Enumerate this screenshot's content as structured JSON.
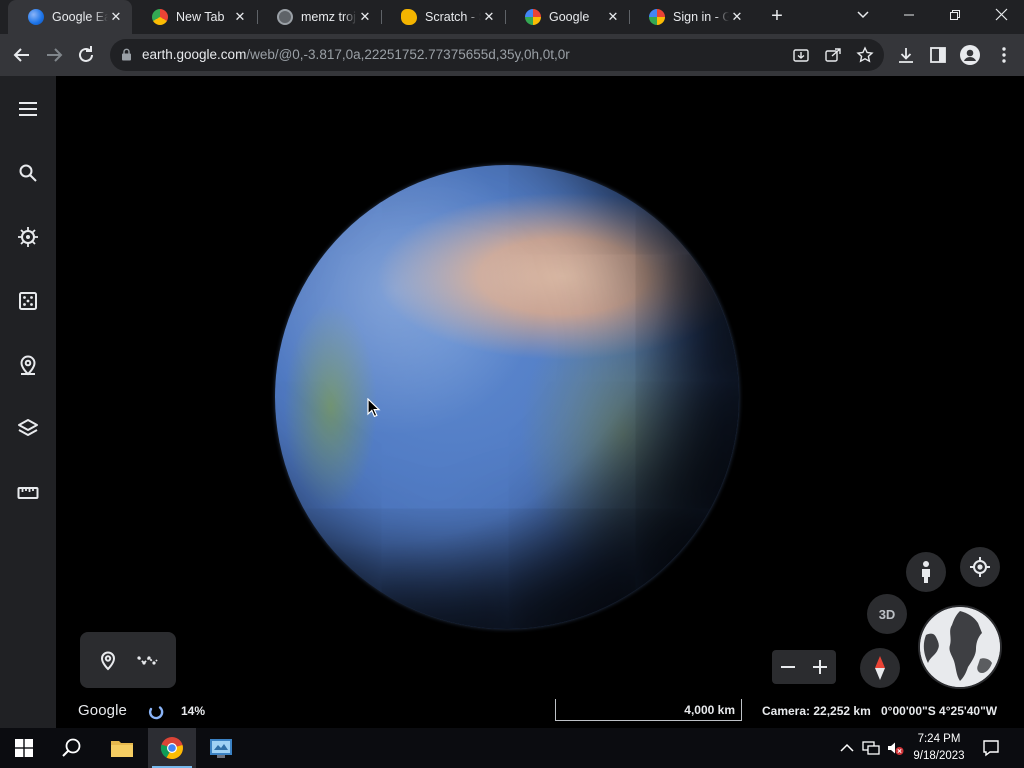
{
  "browser": {
    "tabs": [
      {
        "title": "Google Earth",
        "favicon": "google-earth-icon",
        "active": true
      },
      {
        "title": "New Tab",
        "favicon": "chrome-icon",
        "active": false
      },
      {
        "title": "memz trojan",
        "favicon": "globe-icon",
        "active": false
      },
      {
        "title": "Scratch - Search",
        "favicon": "scratch-icon",
        "active": false
      },
      {
        "title": "Google",
        "favicon": "google-icon",
        "active": false
      },
      {
        "title": "Sign in - Google",
        "favicon": "google-icon",
        "active": false
      }
    ],
    "new_tab_label": "+",
    "address": {
      "host": "earth.google.com",
      "path": "/web/@0,-3.817,0a,22251752.77375655d,35y,0h,0t,0r"
    }
  },
  "earth": {
    "brand": "Google",
    "load_progress": "14%",
    "scale_label": "4,000 km",
    "camera": "Camera: 22,252 km",
    "coordinates": "0°00'00\"S 4°25'40\"W",
    "view_mode_label": "3D",
    "rail_items": [
      "menu-icon",
      "search-icon",
      "voyager-icon",
      "feeling-lucky-icon",
      "projects-icon",
      "map-style-icon",
      "measure-icon"
    ]
  },
  "taskbar": {
    "time": "7:24 PM",
    "date": "9/18/2023"
  },
  "colors": {
    "tab_strip": "#202124",
    "toolbar": "#35363a",
    "rail": "#202124",
    "control_bg": "#2b2c2f"
  }
}
